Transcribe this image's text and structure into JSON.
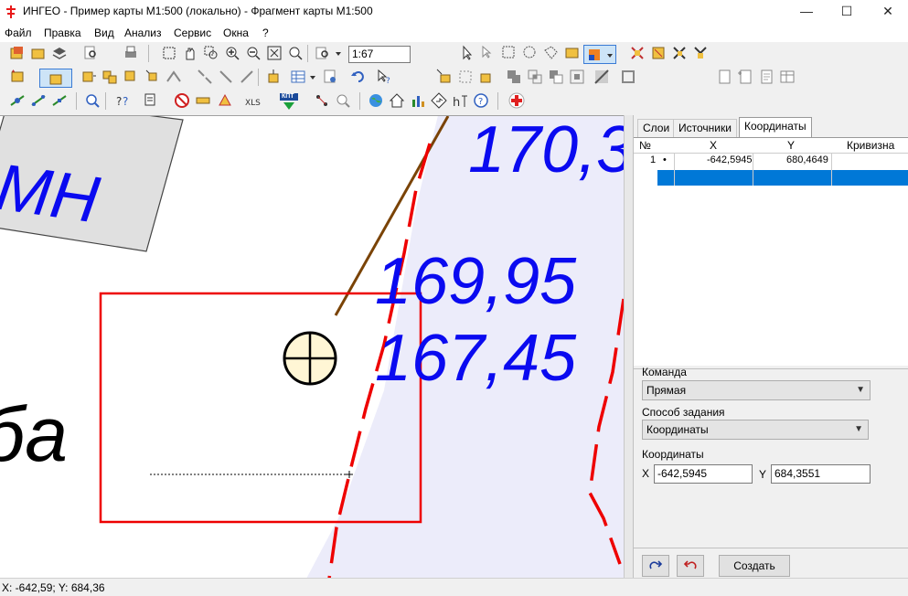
{
  "window": {
    "title": "ИНГЕО - Пример карты М1:500 (локально) - Фрагмент карты М1:500",
    "minimize": "—",
    "maximize": "☐",
    "close": "✕"
  },
  "menu": [
    "Файл",
    "Правка",
    "Вид",
    "Анализ",
    "Сервис",
    "Окна",
    "?"
  ],
  "toolbar": {
    "zoom_value": "1:67",
    "xls_label": "XLS",
    "kpt_label": "КПТ"
  },
  "map": {
    "labels": [
      "170,3",
      "169,95",
      "167,45",
      "МН",
      "ба"
    ],
    "colors": {
      "text_blue": "#0a0af0",
      "boundary_red": "#ee0000",
      "pale_region": "#ececfa",
      "brown_line": "#7a4306",
      "grey_building": "#e0e0e0",
      "point_fill": "#fff6d5"
    }
  },
  "panel": {
    "tabs": [
      "Слои",
      "Источники",
      "Координаты"
    ],
    "active_tab": "Координаты",
    "grid": {
      "headers": [
        "№",
        "X",
        "Y",
        "Кривизна"
      ],
      "rows": [
        {
          "n": "1",
          "mark": "•",
          "x": "-642,5945",
          "y": "680,4649",
          "curv": ""
        }
      ],
      "selected_row_color": "#0078d7"
    },
    "command_label": "Команда",
    "command_value": "Прямая",
    "method_label": "Способ задания",
    "method_value": "Координаты",
    "coords_label": "Координаты",
    "x_label": "X",
    "x_value": "-642,5945",
    "y_label": "Y",
    "y_value": "684,3551",
    "create_button": "Создать"
  },
  "status": {
    "coords": "X: -642,59; Y: 684,36"
  }
}
